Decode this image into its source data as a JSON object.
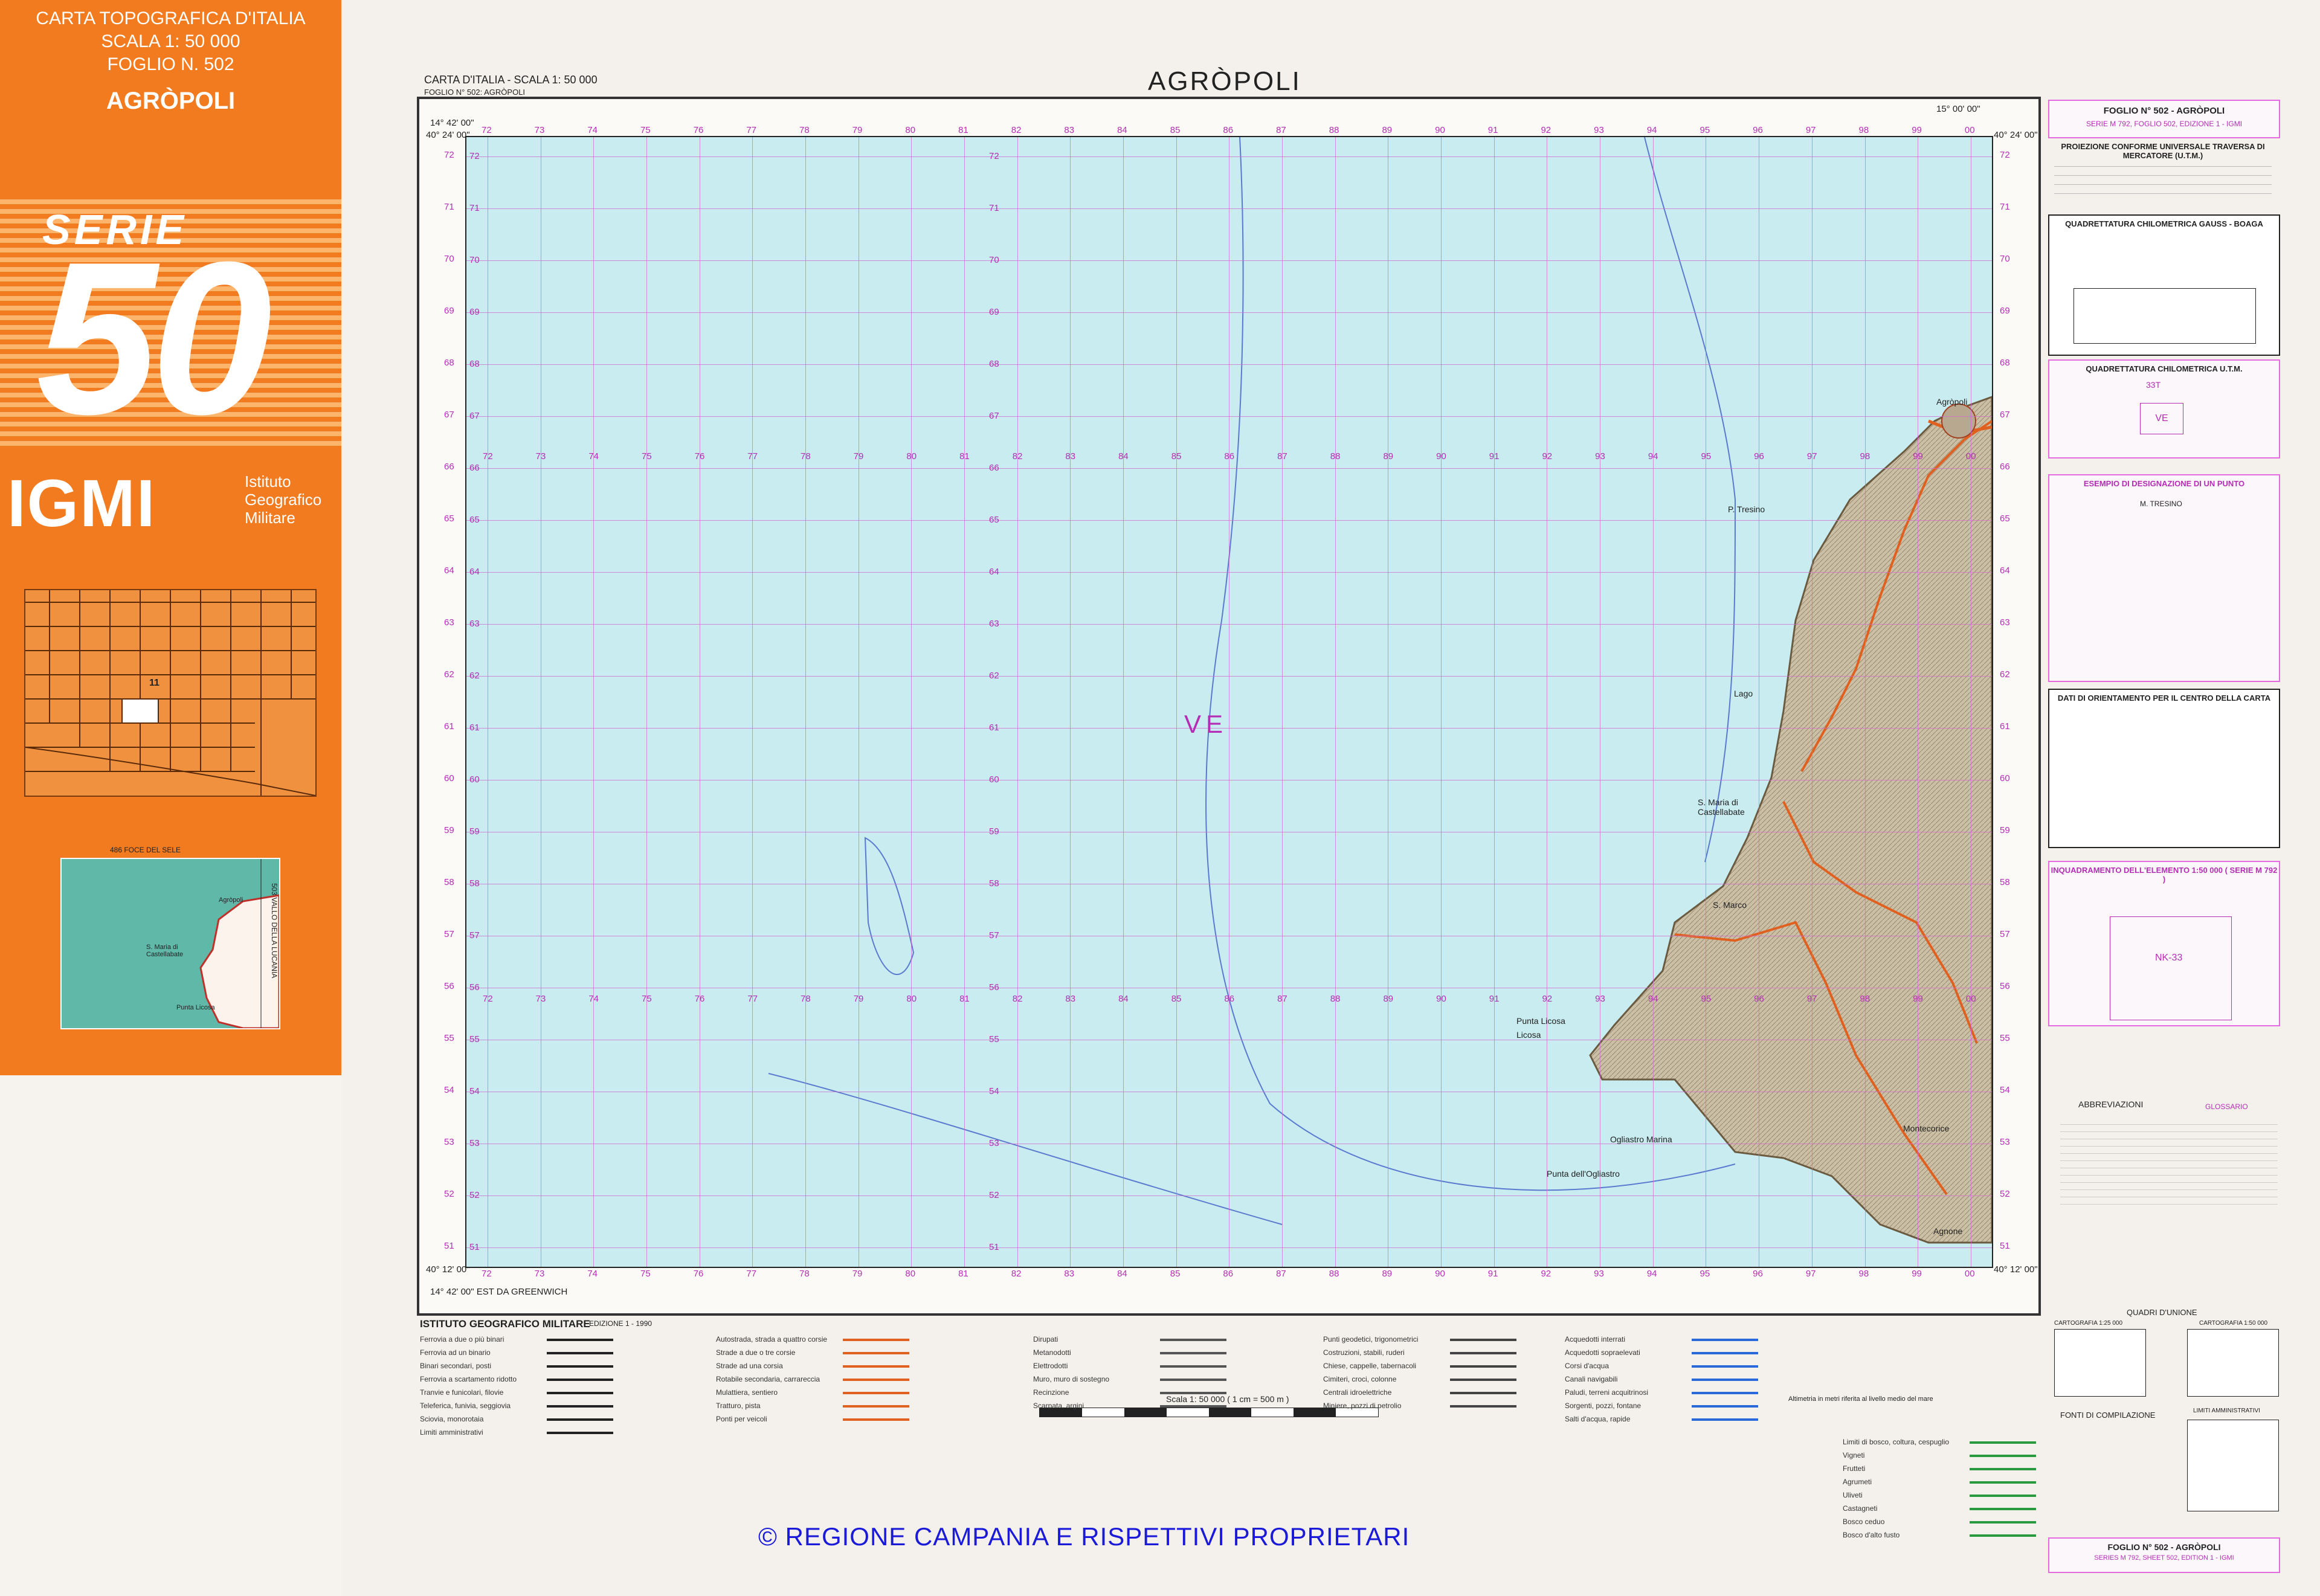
{
  "cover": {
    "line1": "CARTA TOPOGRAFICA D'ITALIA",
    "line2": "SCALA 1: 50 000",
    "line3": "FOGLIO N. 502",
    "sheet_name": "AGRÒPOLI",
    "serie_label": "SERIE",
    "serie_number": "50",
    "publisher_abbr": "IGMI",
    "publisher_line1": "Istituto",
    "publisher_line2": "Geografico",
    "publisher_line3": "Militare",
    "index_sheet_number": "11",
    "inset_top_label": "486 FOCE DEL SELE",
    "inset_side_label": "503 VALLO DELLA LUCANIA",
    "inset_places": [
      "Agròpoli",
      "S. Maria di Castellabate",
      "Punta Licosa"
    ]
  },
  "map": {
    "title": "AGRÒPOLI",
    "subtitle": "CARTA D'ITALIA - SCALA 1: 50 000",
    "sheet": "FOGLIO N° 502: AGRÒPOLI",
    "zone_label": "VE",
    "corner_tl_lon": "14° 42' 00\"",
    "corner_tl_lat": "40° 24' 00\"",
    "corner_tr_lon": "15° 00' 00\"",
    "corner_tr_lat": "40° 24' 00\"",
    "corner_bl_lat": "40° 12' 00\"",
    "corner_br_lat": "40° 12' 00\"",
    "bottom_lon_label": "14° 42' 00\" EST DA GREENWICH",
    "easting_labels": [
      "72",
      "73",
      "74",
      "75",
      "76",
      "77",
      "78",
      "79",
      "80",
      "81",
      "82",
      "83",
      "84",
      "85",
      "86",
      "87",
      "88",
      "89",
      "90",
      "91",
      "92",
      "93",
      "94",
      "95",
      "96",
      "97",
      "98",
      "99",
      "00"
    ],
    "northing_labels": [
      "72",
      "71",
      "70",
      "69",
      "68",
      "67",
      "66",
      "65",
      "64",
      "63",
      "62",
      "61",
      "60",
      "59",
      "58",
      "57",
      "56",
      "55",
      "54",
      "53",
      "52",
      "51"
    ],
    "places": [
      "Agròpoli",
      "S. Maria di Castellabate",
      "S. Marco",
      "Punta Licosa",
      "Ogliastro Marina",
      "Montecorice",
      "Agnone",
      "P. Tresino",
      "Lago",
      "Licosa",
      "Punta dell'Ogliastro"
    ]
  },
  "right_panel": {
    "header_title": "FOGLIO N° 502 - AGRÒPOLI",
    "header_sub": "SERIE M 792, FOGLIO 502, EDIZIONE 1 - IGMI",
    "projection_title": "PROIEZIONE CONFORME UNIVERSALE TRAVERSA DI MERCATORE (U.T.M.)",
    "gauss_title": "QUADRETTATURA CHILOMETRICA GAUSS - BOAGA",
    "utm_title": "QUADRETTATURA CHILOMETRICA U.T.M.",
    "utm_zone": "33T",
    "utm_square": "VE",
    "example_title": "ESEMPIO DI DESIGNAZIONE DI UN PUNTO",
    "example_point": "M. TRESINO",
    "orientation_title": "DATI DI ORIENTAMENTO PER IL CENTRO DELLA CARTA",
    "inquadramento_title": "INQUADRAMENTO DELL'ELEMENTO 1:50 000 ( SERIE M 792 )",
    "inquadramento_zone": "NK-33",
    "abbreviazioni_title": "ABBREVIAZIONI",
    "glossario_title": "GLOSSARIO",
    "quadri_title": "QUADRI D'UNIONE",
    "cartografia_1": "CARTOGRAFIA 1:25 000",
    "cartografia_2": "CARTOGRAFIA 1:50 000",
    "limiti_title": "LIMITI AMMINISTRATIVI",
    "fonti_title": "FONTI DI COMPILAZIONE",
    "footer_sheet": "FOGLIO N° 502 - AGRÒPOLI",
    "footer_series": "SERIES M 792, SHEET 502, EDITION 1 - IGMI"
  },
  "legend": {
    "publisher": "ISTITUTO GEOGRAFICO MILITARE",
    "edition": "EDIZIONE 1 - 1990",
    "scale_label": "Scala 1: 50 000 ( 1 cm = 500 m )",
    "altimetry_note": "Altimetria in metri riferita al livello medio del mare",
    "items_col1": [
      "Ferrovia a due o più binari",
      "Ferrovia ad un binario",
      "Binari secondari, posti",
      "Ferrovia a scartamento ridotto",
      "Tranvie e funicolari, filovie",
      "Teleferica, funivia, seggiovia",
      "Sciovia, monorotaia",
      "Limiti amministrativi"
    ],
    "items_col2": [
      "Autostrada, strada a quattro corsie",
      "Strade a due o tre corsie",
      "Strade ad una corsia",
      "Rotabile secondaria, carrareccia",
      "Mulattiera, sentiero",
      "Tratturo, pista",
      "Ponti per veicoli"
    ],
    "items_col3": [
      "Dirupati",
      "Metanodotti",
      "Elettrodotti",
      "Muro, muro di sostegno",
      "Recinzione",
      "Scarpata, argini"
    ],
    "items_col4": [
      "Punti geodetici, trigonometrici",
      "Costruzioni, stabili, ruderi",
      "Chiese, cappelle, tabernacoli",
      "Cimiteri, croci, colonne",
      "Centrali idroelettriche",
      "Miniere, pozzi di petrolio"
    ],
    "items_col5": [
      "Acquedotti interrati",
      "Acquedotti sopraelevati",
      "Corsi d'acqua",
      "Canali navigabili",
      "Paludi, terreni acquitrinosi",
      "Sorgenti, pozzi, fontane",
      "Salti d'acqua, rapide"
    ],
    "items_col6": [
      "Limiti di bosco, coltura, cespuglio",
      "Vigneti",
      "Frutteti",
      "Agrumeti",
      "Uliveti",
      "Castagneti",
      "Bosco ceduo",
      "Bosco d'alto fusto"
    ]
  },
  "footer": {
    "copyright": "© REGIONE CAMPANIA E RISPETTIVI PROPRIETARI"
  },
  "colors": {
    "cover_orange": "#f27a1f",
    "sea": "#c8ecef",
    "grid_magenta": "#b52db5",
    "land": "#cbbfa6",
    "roads": "#e06020",
    "copyright_blue": "#1a1ad8"
  }
}
